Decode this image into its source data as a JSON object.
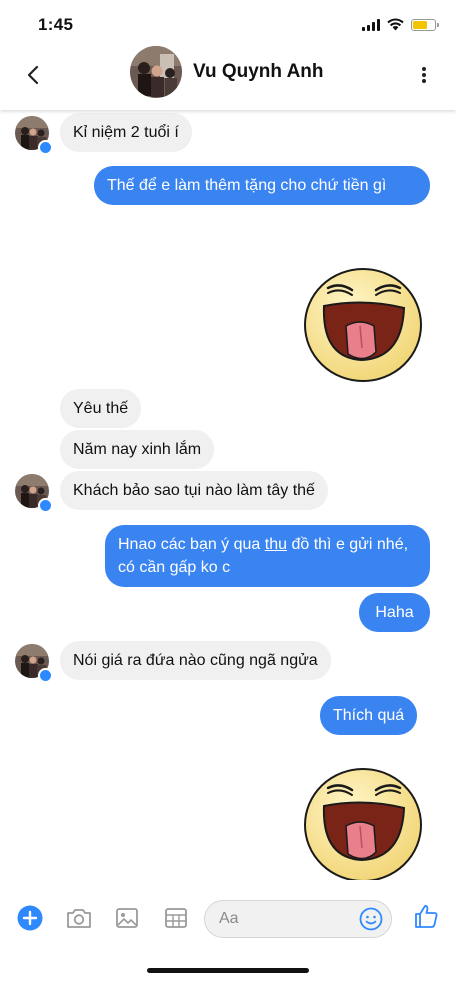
{
  "status": {
    "time": "1:45"
  },
  "header": {
    "contact_name": "Vu Quynh Anh"
  },
  "messages": [
    {
      "side": "in",
      "text": "Kỉ niệm 2 tuổi í"
    },
    {
      "side": "out",
      "text": "Thế để e làm thêm tặng cho chứ tiền gì"
    },
    {
      "side": "out",
      "type": "sticker",
      "icon": "laughing-tongue-sticker"
    },
    {
      "side": "in",
      "text": "Yêu thế"
    },
    {
      "side": "in",
      "text": "Năm nay xinh lắm"
    },
    {
      "side": "in",
      "text": "Khách bảo sao tụi nào làm tây thế"
    },
    {
      "side": "out",
      "text_pre": "Hnao các bạn ý qua ",
      "text_link": "thu",
      "text_post": " đồ thì e gửi nhé, có cần gấp ko c"
    },
    {
      "side": "out",
      "text": "Haha"
    },
    {
      "side": "in",
      "text": "Nói giá ra đứa nào cũng ngã ngửa"
    },
    {
      "side": "out",
      "text": "Thích quá"
    },
    {
      "side": "out",
      "type": "sticker",
      "icon": "laughing-tongue-sticker"
    }
  ],
  "composer": {
    "placeholder": "Aa"
  },
  "colors": {
    "accent": "#3a84f2",
    "incoming_bubble": "#f0f0f0",
    "messenger_badge": "#2e89ff"
  }
}
